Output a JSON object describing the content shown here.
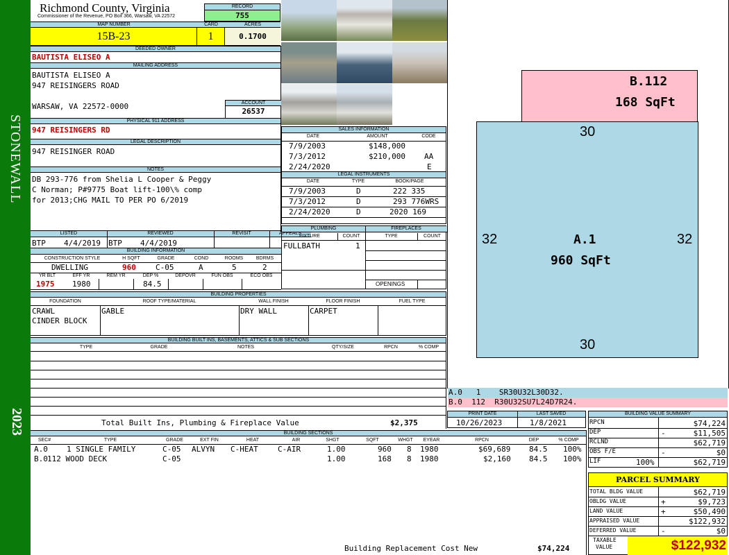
{
  "sidebar": {
    "district": "STONEWALL",
    "year": "2023"
  },
  "header": {
    "county": "Richmond County, Virginia",
    "office": "Commissioner of the Revenue, PO Box 366, Warsaw, VA 22572",
    "record_label": "RECORD",
    "record": "755",
    "map_label": "MAP NUMBER",
    "map": "15B-23",
    "card_label": "CARD",
    "card": "1",
    "acres_label": "ACRES",
    "acres": "0.1700"
  },
  "owner": {
    "deeded_label": "DEEDED OWNER",
    "deeded": "BAUTISTA ELISEO A",
    "mailing_label": "MAILING ADDRESS",
    "mail1": "BAUTISTA ELISEO A",
    "mail2": "947 REISINGERS ROAD",
    "mail3": "WARSAW, VA 22572-0000",
    "account_label": "ACCOUNT",
    "account": "26537",
    "phys_label": "PHYSICAL 911 ADDRESS",
    "phys": "947 REISINGERS RD",
    "legal_label": "LEGAL DESCRIPTION",
    "legal": "947 REISINGER ROAD",
    "notes_label": "NOTES",
    "notes1": "DB 293-776 from Shelia L Cooper & Peggy",
    "notes2": "C Norman; P#9775 Boat lift-100\\% comp",
    "notes3": "for 2013;CHG MAIL TO PER PO 6/2019"
  },
  "sales": {
    "title": "SALES INFORMATION",
    "cols": [
      "DATE",
      "AMOUNT",
      "CODE"
    ],
    "rows": [
      {
        "date": "7/9/2003",
        "amount": "$148,000",
        "code": ""
      },
      {
        "date": "7/3/2012",
        "amount": "$210,000",
        "code": "AA"
      },
      {
        "date": "2/24/2020",
        "amount": "",
        "code": "E"
      }
    ]
  },
  "legal_instr": {
    "title": "LEGAL INSTRUMENTS",
    "cols": [
      "DATE",
      "TYPE",
      "BOOK/PAGE"
    ],
    "rows": [
      {
        "date": "7/9/2003",
        "type": "D",
        "book": "222 335"
      },
      {
        "date": "7/3/2012",
        "type": "D",
        "book": "293 776WRS"
      },
      {
        "date": "2/24/2020",
        "type": "D",
        "book": "2020 169"
      }
    ]
  },
  "review": {
    "cols": [
      "LISTED",
      "REVIEWED",
      "REVISIT",
      "APPEALS"
    ],
    "listed_by": "BTP",
    "listed_date": "4/4/2019",
    "reviewed_by": "BTP",
    "reviewed_date": "4/4/2019"
  },
  "plumbing": {
    "title": "PLUMBING",
    "cols": [
      "FIXTURE",
      "COUNT"
    ],
    "fixture": "FULLBATH",
    "count": "1"
  },
  "fireplaces": {
    "title": "FIREPLACES",
    "cols": [
      "TYPE",
      "COUNT"
    ],
    "openings": "OPENINGS"
  },
  "building_info": {
    "title": "BUILDING INFORMATION",
    "cols1": [
      "CONSTRUCTION STYLE",
      "H SQFT",
      "GRADE",
      "COND",
      "ROOMS",
      "BDRMS"
    ],
    "style": "DWELLING",
    "hsqft": "960",
    "grade": "C-05",
    "cond": "A",
    "rooms": "5",
    "bdrms": "2",
    "cols2": [
      "YR BLT",
      "EFF YR",
      "REM YR",
      "DEP %",
      "DEPOVR",
      "FUN OBS",
      "ECO OBS"
    ],
    "yrblt": "1975",
    "effyr": "1980",
    "remyr": "",
    "dep": "84.5"
  },
  "props": {
    "title": "BUILDING PROPERTIES",
    "cols": [
      "FOUNDATION",
      "ROOF TYPE/MATERIAL",
      "WALL FINISH",
      "FLOOR FINISH",
      "FUEL TYPE"
    ],
    "foundation1": "CRAWL",
    "foundation2": "CINDER BLOCK",
    "roof": "GABLE",
    "wall": "DRY WALL",
    "floor": "CARPET"
  },
  "builtins": {
    "title": "BUILDING BUILT INS, BASEMENTS, ATTICS & SUB SECTIONS",
    "cols": [
      "TYPE",
      "GRADE",
      "NOTES",
      "QTY/SIZE",
      "RPCN",
      "% COMP"
    ],
    "total_label": "Total Built Ins, Plumbing & Fireplace Value",
    "total": "$2,375"
  },
  "sketch": {
    "b_label": "B.112",
    "b_area": "168 SqFt",
    "a_label": "A.1",
    "a_area": "960 SqFt",
    "top": "30",
    "bottom": "30",
    "left": "32",
    "right": "32",
    "code_a": "A.0   1    SR30U32L30D32.",
    "code_b": "B.0  112  R30U32SU7L24D7R24.",
    "colors": {
      "a": "#add8e6",
      "b": "#ffc0cb"
    }
  },
  "dates": {
    "print_label": "PRINT DATE",
    "print": "10/26/2023",
    "saved_label": "LAST SAVED",
    "saved": "1/8/2021"
  },
  "sections": {
    "title": "BUILDING SECTIONS",
    "cols": [
      "SEC#",
      "TYPE",
      "GRADE",
      "EXT FIN",
      "HEAT",
      "AIR",
      "SHGT",
      "SQFT",
      "WHGT",
      "EYEAR",
      "RPCN",
      "DEP",
      "% COMP"
    ],
    "rows": [
      {
        "sec": "A.0",
        "type": "1 SINGLE FAMILY",
        "grade": "C-05",
        "ext": "ALVYN",
        "heat": "C-HEAT",
        "air": "C-AIR",
        "shgt": "1.00",
        "sqft": "960",
        "whgt": "8",
        "eyear": "1980",
        "rpcn": "$69,689",
        "dep": "84.5",
        "comp": "100%"
      },
      {
        "sec": "B.0",
        "type": "112 WOOD DECK",
        "grade": "C-05",
        "ext": "",
        "heat": "",
        "air": "",
        "shgt": "1.00",
        "sqft": "168",
        "whgt": "8",
        "eyear": "1980",
        "rpcn": "$2,160",
        "dep": "84.5",
        "comp": "100%"
      }
    ],
    "replacement_label": "Building Replacement Cost New",
    "replacement": "$74,224"
  },
  "bvs": {
    "title": "BUILDING VALUE SUMMARY",
    "rows": [
      {
        "label": "RPCN",
        "sign": "",
        "value": "$74,224"
      },
      {
        "label": "DEP",
        "sign": "-",
        "value": "$11,505"
      },
      {
        "label": "RCLND",
        "sign": "",
        "value": "$62,719"
      },
      {
        "label": "OBS F/E",
        "sign": "-",
        "value": "$0"
      },
      {
        "label": "LIF",
        "sign": "",
        "pct": "100%",
        "value": "$62,719"
      }
    ]
  },
  "parcel": {
    "title": "PARCEL SUMMARY",
    "rows": [
      {
        "label": "TOTAL BLDG VALUE",
        "sign": "",
        "value": "$62,719"
      },
      {
        "label": "OBLDG VALUE",
        "sign": "+",
        "value": "$9,723"
      },
      {
        "label": "LAND VALUE",
        "sign": "+",
        "value": "$50,490"
      },
      {
        "label": "APPRAISED VALUE",
        "sign": "",
        "value": "$122,932"
      },
      {
        "label": "DEFERRED VALUE",
        "sign": "-",
        "value": "$0"
      }
    ],
    "taxable_label1": "TAXABLE",
    "taxable_label2": "VALUE",
    "taxable": "$122,932"
  },
  "photos": [
    "building-photo-1",
    "building-photo-2",
    "building-photo-3",
    "building-photo-4",
    "building-photo-5",
    "building-photo-6",
    "building-photo-7",
    "building-photo-8"
  ]
}
